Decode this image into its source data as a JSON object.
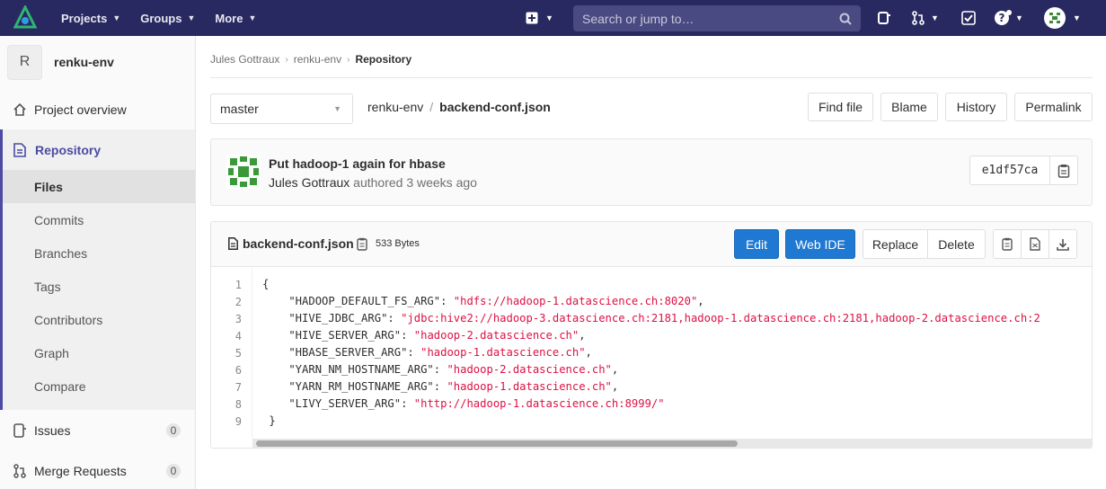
{
  "topbar": {
    "nav": [
      {
        "label": "Projects"
      },
      {
        "label": "Groups"
      },
      {
        "label": "More"
      }
    ],
    "search_placeholder": "Search or jump to…"
  },
  "sidebar": {
    "project_initial": "R",
    "project_name": "renku-env",
    "project_overview": "Project overview",
    "repository": "Repository",
    "repo_items": [
      "Files",
      "Commits",
      "Branches",
      "Tags",
      "Contributors",
      "Graph",
      "Compare"
    ],
    "issues": {
      "label": "Issues",
      "count": "0"
    },
    "merge_requests": {
      "label": "Merge Requests",
      "count": "0"
    }
  },
  "breadcrumb": {
    "owner": "Jules Gottraux",
    "project": "renku-env",
    "current": "Repository"
  },
  "toolbar": {
    "branch": "master",
    "path_root": "renku-env",
    "path_file": "backend-conf.json",
    "find_file": "Find file",
    "blame": "Blame",
    "history": "History",
    "permalink": "Permalink"
  },
  "commit": {
    "title": "Put hadoop-1 again for hbase",
    "author": "Jules Gottraux",
    "authored_text": "authored 3 weeks ago",
    "sha": "e1df57ca"
  },
  "file": {
    "name": "backend-conf.json",
    "size": "533 Bytes",
    "edit": "Edit",
    "web_ide": "Web IDE",
    "replace": "Replace",
    "delete": "Delete",
    "lines": [
      {
        "n": "1",
        "key": "{",
        "val": ""
      },
      {
        "n": "2",
        "key": "    \"HADOOP_DEFAULT_FS_ARG\": ",
        "val": "\"hdfs://hadoop-1.datascience.ch:8020\"",
        "tail": ","
      },
      {
        "n": "3",
        "key": "    \"HIVE_JDBC_ARG\": ",
        "val": "\"jdbc:hive2://hadoop-3.datascience.ch:2181,hadoop-1.datascience.ch:2181,hadoop-2.datascience.ch:2",
        "tail": ""
      },
      {
        "n": "4",
        "key": "    \"HIVE_SERVER_ARG\": ",
        "val": "\"hadoop-2.datascience.ch\"",
        "tail": ","
      },
      {
        "n": "5",
        "key": "    \"HBASE_SERVER_ARG\": ",
        "val": "\"hadoop-1.datascience.ch\"",
        "tail": ","
      },
      {
        "n": "6",
        "key": "    \"YARN_NM_HOSTNAME_ARG\": ",
        "val": "\"hadoop-2.datascience.ch\"",
        "tail": ","
      },
      {
        "n": "7",
        "key": "    \"YARN_RM_HOSTNAME_ARG\": ",
        "val": "\"hadoop-1.datascience.ch\"",
        "tail": ","
      },
      {
        "n": "8",
        "key": "    \"LIVY_SERVER_ARG\": ",
        "val": "\"http://hadoop-1.datascience.ch:8999/\"",
        "tail": ""
      },
      {
        "n": "9",
        "key": " }",
        "val": ""
      }
    ]
  },
  "colors": {
    "topbar": "#292961",
    "accent": "#4b4ba3",
    "primary_button": "#1f78d1",
    "string": "#dd1144"
  }
}
